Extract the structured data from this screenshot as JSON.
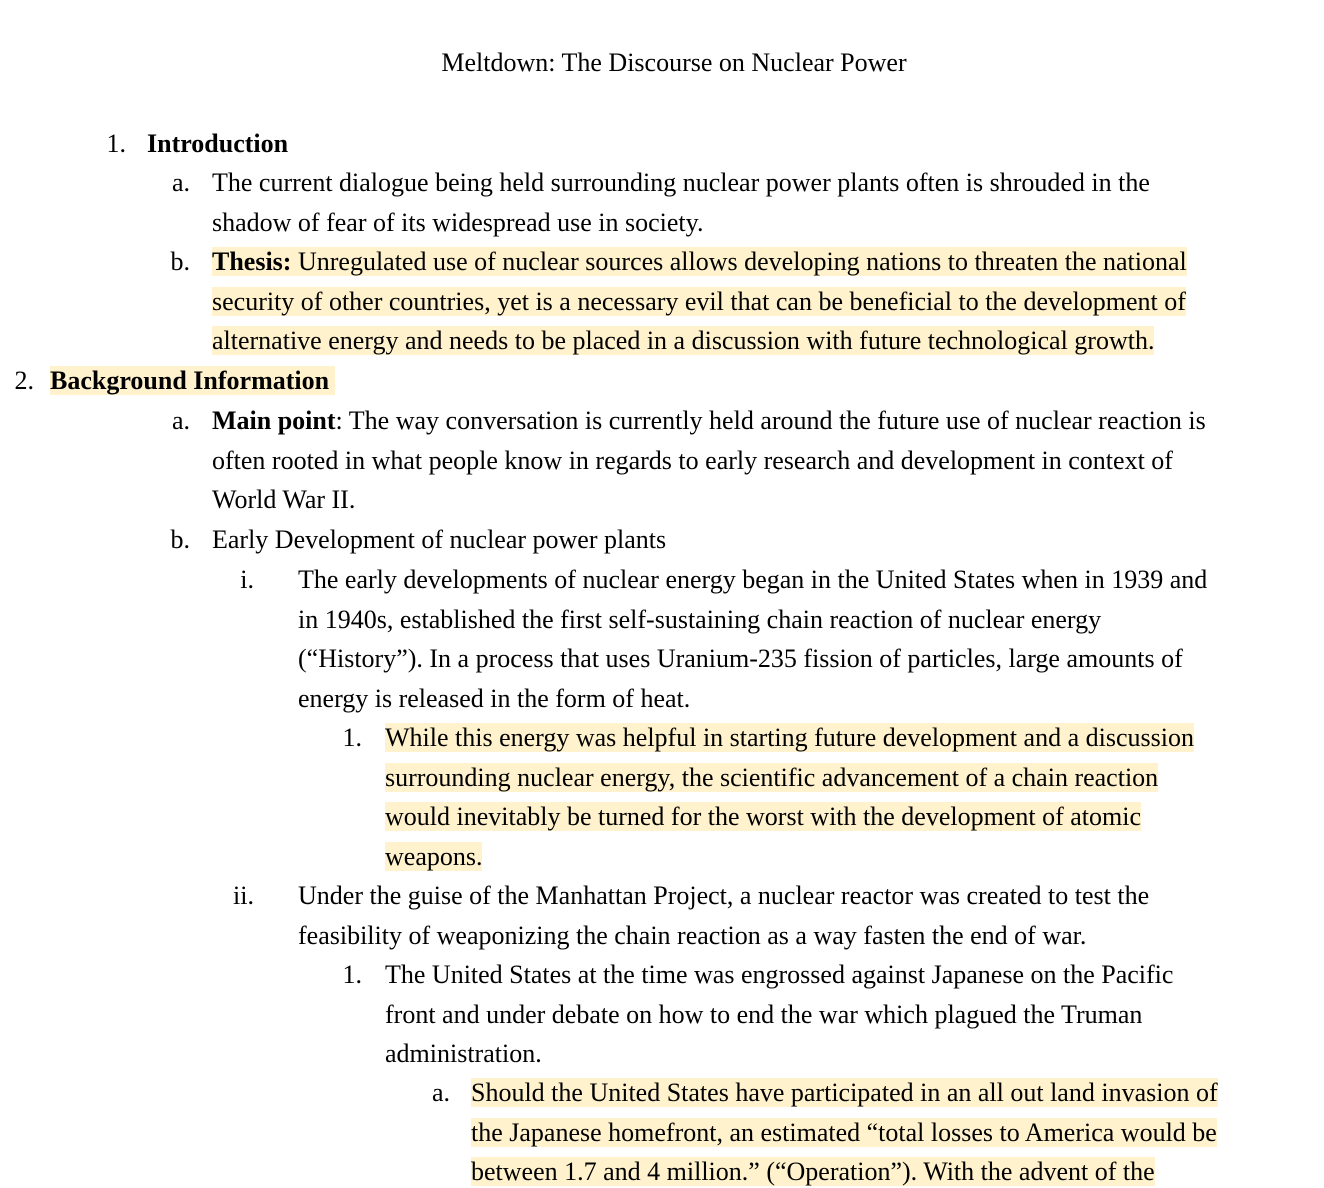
{
  "document": {
    "title": "Meltdown: The Discourse on Nuclear Power",
    "highlight_color": "#fff2cc",
    "outline": {
      "s1": {
        "marker": "1.",
        "heading": "Introduction",
        "a": {
          "marker": "a.",
          "line1": "The current dialogue being held surrounding nuclear power plants often is shrouded in the",
          "line2": "shadow of fear of its widespread use in society."
        },
        "b": {
          "marker": "b.",
          "label": "Thesis:",
          "line1": " Unregulated use of nuclear sources allows developing nations to threaten the national",
          "line2": "security of other countries, yet is a necessary evil that can be beneficial to the development of",
          "line3": "alternative energy and needs to be placed in a discussion with future technological growth."
        }
      },
      "s2": {
        "marker": "2.",
        "heading": "Background Information",
        "a": {
          "marker": "a.",
          "label": "Main point",
          "line1": ": The way conversation is currently held around the future use of nuclear reaction is",
          "line2": "often rooted in what people know in regards to early research and development in context of",
          "line3": "World War II."
        },
        "b": {
          "marker": "b.",
          "text": "Early Development of nuclear power plants",
          "i": {
            "marker": "i.",
            "line1": "The early developments of nuclear energy began in the United States when in 1939 and",
            "line2": "in 1940s, established the first self-sustaining chain reaction of nuclear energy",
            "line3": "(“History”). In a process that uses Uranium-235 fission of particles, large amounts of",
            "line4": "energy is released in the form of heat.",
            "p1": {
              "marker": "1.",
              "line1": "While this energy was helpful in starting future development and a discussion",
              "line2": "surrounding nuclear energy, the scientific advancement of a chain reaction",
              "line3": "would inevitably be turned for the worst with the development of atomic",
              "line4": "weapons."
            }
          },
          "ii": {
            "marker": "ii.",
            "line1": "Under the guise of the Manhattan Project, a nuclear reactor was created to test the",
            "line2": "feasibility of weaponizing the chain reaction as a way fasten the end of war.",
            "p1": {
              "marker": "1.",
              "line1": "The United States at the time was engrossed against Japanese on the Pacific",
              "line2": "front and under debate on how to end the war which plagued the Truman",
              "line3": "administration.",
              "a": {
                "marker": "a.",
                "line1": "Should the United States have participated in an all out land invasion of",
                "line2": "the Japanese homefront, an estimated “total losses to America would be",
                "line3": "between 1.7 and 4 million.” (“Operation”). With the advent of the"
              }
            }
          }
        }
      }
    }
  }
}
